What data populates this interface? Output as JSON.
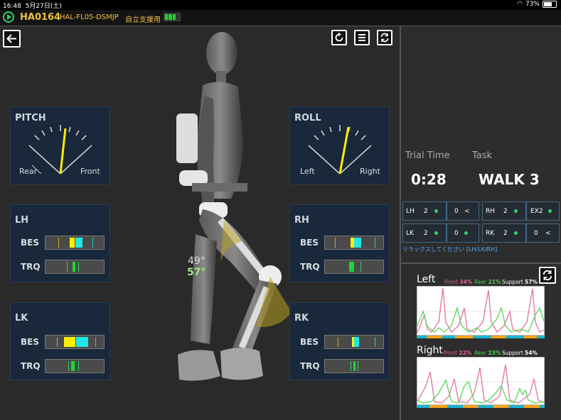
{
  "status_bar": {
    "time": "16:48",
    "date": "5月27日(土)",
    "battery": "73%"
  },
  "device": {
    "id": "HA0164",
    "model": "HAL-FL05-DSMJP",
    "mode": "自立支援用"
  },
  "toolbar": {
    "back_icon": "arrow-left-icon",
    "reset_icon": "rotate-icon",
    "menu_icon": "hamburger-icon",
    "sync_icon": "sync-icon"
  },
  "pitch": {
    "title": "PITCH",
    "left_label": "Rear",
    "right_label": "Front",
    "needle_deg": 6
  },
  "roll": {
    "title": "ROLL",
    "left_label": "Left",
    "right_label": "Right",
    "needle_deg": 10
  },
  "joint_panels": {
    "lh": {
      "title": "LH",
      "bes": "BES",
      "trq": "TRQ"
    },
    "rh": {
      "title": "RH",
      "bes": "BES",
      "trq": "TRQ"
    },
    "lk": {
      "title": "LK",
      "bes": "BES",
      "trq": "TRQ"
    },
    "rk": {
      "title": "RK",
      "bes": "BES",
      "trq": "TRQ"
    }
  },
  "angles": {
    "hip": "49°",
    "knee": "57°"
  },
  "trial": {
    "time_label": "Trial Time",
    "task_label": "Task",
    "time": "0:28",
    "task": "WALK 3"
  },
  "settings_grid": [
    {
      "joint": "LH",
      "v1": "2",
      "v2": "0",
      "s2": "chevron"
    },
    {
      "joint": "RH",
      "v1": "2",
      "v2": "EX2",
      "s2": "dot"
    },
    {
      "joint": "LK",
      "v1": "2",
      "v2": "0",
      "s2": "dot"
    },
    {
      "joint": "RK",
      "v1": "2",
      "v2": "0",
      "s2": "chevron"
    }
  ],
  "relax_msg": "リラックスしてください [LH/LK/RH]",
  "left_load": {
    "title": "Left",
    "front_label": "Front",
    "front": "34%",
    "rear_label": "Rear",
    "rear": "21%",
    "support_label": "Support",
    "support": "57%"
  },
  "right_load": {
    "title": "Right",
    "front_label": "Front",
    "front": "22%",
    "rear_label": "Rear",
    "rear": "23%",
    "support_label": "Support",
    "support": "54%"
  },
  "colors": {
    "accent": "#f0c040",
    "panel": "#19283a",
    "green": "#2fd36a",
    "bes_yellow": "#ffee00",
    "bes_cyan": "#22e6e6",
    "front_pink": "#e7609a",
    "rear_green": "#4fcf4f"
  }
}
